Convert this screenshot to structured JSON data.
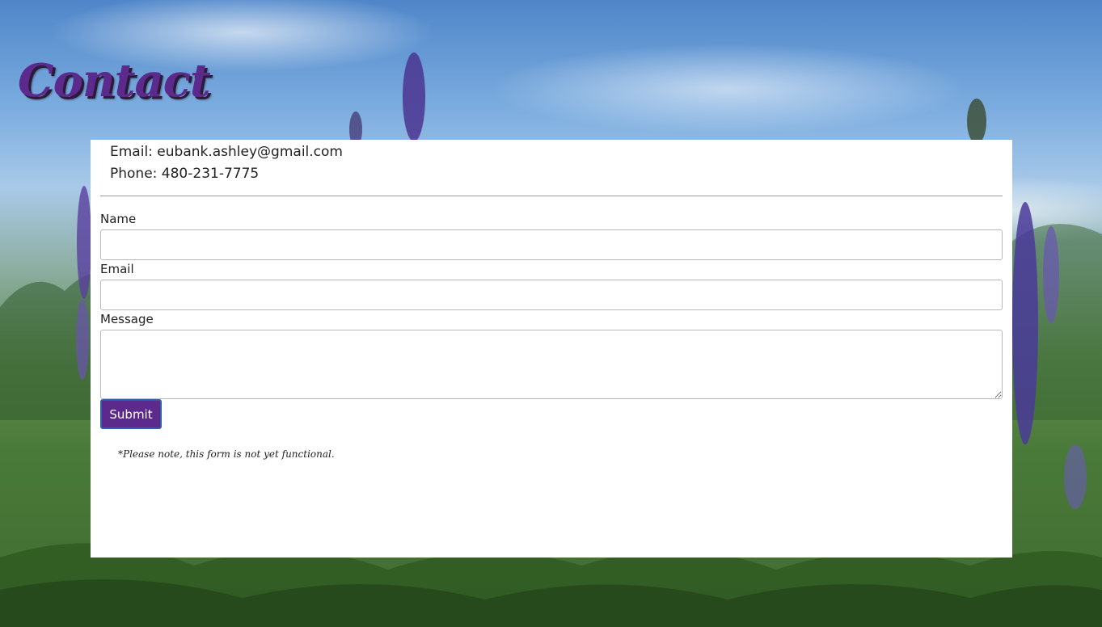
{
  "page": {
    "title": "Contact"
  },
  "contact": {
    "email_line": "Email: eubank.ashley@gmail.com",
    "phone_line": "Phone: 480-231-7775"
  },
  "form": {
    "name_label": "Name",
    "name_value": "",
    "email_label": "Email",
    "email_value": "",
    "message_label": "Message",
    "message_value": "",
    "submit_label": "Submit",
    "note": "*Please note, this form is not yet functional."
  },
  "colors": {
    "accent": "#5b2a8c",
    "panel_background": "#ffffff",
    "button_border": "#2f5fa8"
  }
}
